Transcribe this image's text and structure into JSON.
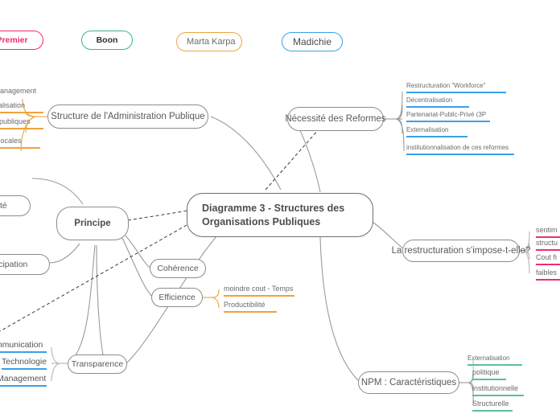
{
  "diagram": {
    "title": "Diagramme 3 -  Structures des Organisations Publiques",
    "center_line1": "Diagramme 3 -  Structures des",
    "center_line2": "Organisations Publiques",
    "colors": {
      "blue": "#3aa0e8",
      "pink": "#ef2e6a",
      "green": "#38b58b",
      "orange": "#f0a33c",
      "teal": "#5bbfa0",
      "node_border": "#8c8c8c",
      "text": "#5a5a5a"
    }
  },
  "tags": [
    {
      "label": "Premier",
      "color": "#ef2e6a",
      "bold": true
    },
    {
      "label": "Boon",
      "color": "#38b58b",
      "bold": true
    },
    {
      "label": "Marta Karpa",
      "color": "#f0a33c",
      "bold": false
    },
    {
      "label": "Madichie",
      "color": "#3aa0e8",
      "bold": false
    }
  ],
  "branches": {
    "structure_admin": {
      "label": "Structure de l'Administration Publique",
      "children": [
        {
          "label": "de management",
          "color": "#f0a33c"
        },
        {
          "label": "centralisation",
          "color": "#f0a33c"
        },
        {
          "label": "ons publiques",
          "color": "#f0a33c"
        },
        {
          "label": "ités locales",
          "color": "#f0a33c"
        }
      ]
    },
    "necessite_reformes": {
      "label": "Nécessité des Reformes",
      "children": [
        {
          "label": "Restructuration \"Workforce\"",
          "color": "#3aa0e8"
        },
        {
          "label": "Décentralisation",
          "color": "#3aa0e8"
        },
        {
          "label": "Partenariat-Public-Privé (3P",
          "color": "#3aa0e8"
        },
        {
          "label": "Externalisation",
          "color": "#3aa0e8"
        },
        {
          "label": "institutionnalisation de ces reformes",
          "color": "#3aa0e8"
        }
      ]
    },
    "restructuration_question": {
      "label": "La restructuration s'impose-t-elle?",
      "children": [
        {
          "label": "sentim",
          "color": "#ef2e6a"
        },
        {
          "label": "structu",
          "color": "#ef2e6a"
        },
        {
          "label": "Cout fi",
          "color": "#ef2e6a"
        },
        {
          "label": "faibles",
          "color": "#ef2e6a"
        }
      ]
    },
    "npm": {
      "label": "NPM : Caractéristiques",
      "children": [
        {
          "label": "Externalisation",
          "color": "#5bbfa0"
        },
        {
          "label": "politique",
          "color": "#5bbfa0"
        },
        {
          "label": "institutionnelle",
          "color": "#5bbfa0"
        },
        {
          "label": "Structurelle",
          "color": "#5bbfa0"
        }
      ]
    },
    "principe": {
      "label": "Principe",
      "children": [
        {
          "label": "lité"
        },
        {
          "label": "articipation"
        },
        {
          "label": "Cohérence"
        },
        {
          "label": "Efficience"
        }
      ]
    },
    "efficience": {
      "label": "Efficience",
      "children": [
        {
          "label": "moindre cout - Temps",
          "color": "#f0a33c"
        },
        {
          "label": "Productibilité",
          "color": "#f0a33c"
        }
      ]
    },
    "transparence": {
      "label": "Transparence",
      "children": [
        {
          "label": "ommunication",
          "color": "#3aa0e8"
        },
        {
          "label": "Technologie",
          "color": "#3aa0e8"
        },
        {
          "label": "Management",
          "color": "#3aa0e8"
        }
      ]
    },
    "responsabilite": {
      "label": "lité"
    },
    "participation": {
      "label": "articipation"
    },
    "coherence": {
      "label": "Cohérence"
    }
  }
}
